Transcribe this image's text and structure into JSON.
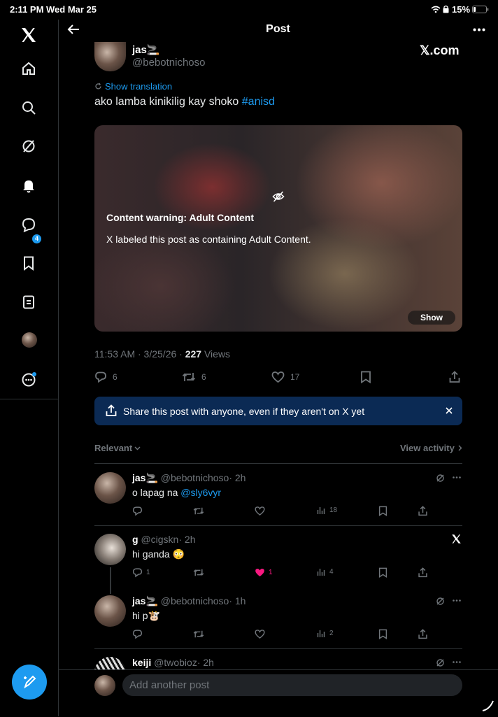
{
  "status_bar": {
    "time": "2:11 PM",
    "date": "Wed Mar 25",
    "battery": "15%"
  },
  "header": {
    "title": "Post"
  },
  "sidebar": {
    "messages_badge": "4"
  },
  "post": {
    "author_name": "jas🚬",
    "author_handle": "@bebotnichoso",
    "watermark": "𝕏.com",
    "show_translation": "Show translation",
    "text": "ako lamba kinikilig kay shoko ",
    "hashtag": "#anisd",
    "content_warning_title": "Content warning: Adult Content",
    "content_warning_body": "X labeled this post as containing Adult Content.",
    "show_label": "Show",
    "timestamp": "11:53 AM · 3/25/26 · ",
    "views_count": "227",
    "views_label": " Views",
    "replies": "6",
    "reposts": "6",
    "likes": "17"
  },
  "share_banner": {
    "text": "Share this post with anyone, even if they aren't on X yet"
  },
  "sort": {
    "relevant": "Relevant",
    "view_activity": "View activity"
  },
  "replies": [
    {
      "name": "jas🚬",
      "handle": "@bebotnichoso",
      "time": "· 2h",
      "text": "o lapag na ",
      "mention": "@sly6vyr",
      "replies": "",
      "reposts": "",
      "likes": "",
      "views": "18"
    },
    {
      "name": "g",
      "handle": "@cigskn",
      "time": "· 2h",
      "text": "hi ganda 😳",
      "mention": "",
      "replies": "1",
      "reposts": "",
      "likes": "1",
      "views": "4"
    },
    {
      "name": "jas🚬",
      "handle": "@bebotnichoso",
      "time": "· 1h",
      "text": "hi p🐮",
      "mention": "",
      "replies": "",
      "reposts": "",
      "likes": "",
      "views": "2"
    },
    {
      "name": "keiji",
      "handle": "@twobioz",
      "time": "· 2h"
    }
  ],
  "composer": {
    "placeholder": "Add another post"
  },
  "colors": {
    "accent": "#1d9bf0",
    "like_pink": "#f91880",
    "banner_bg": "#0b2a54"
  }
}
